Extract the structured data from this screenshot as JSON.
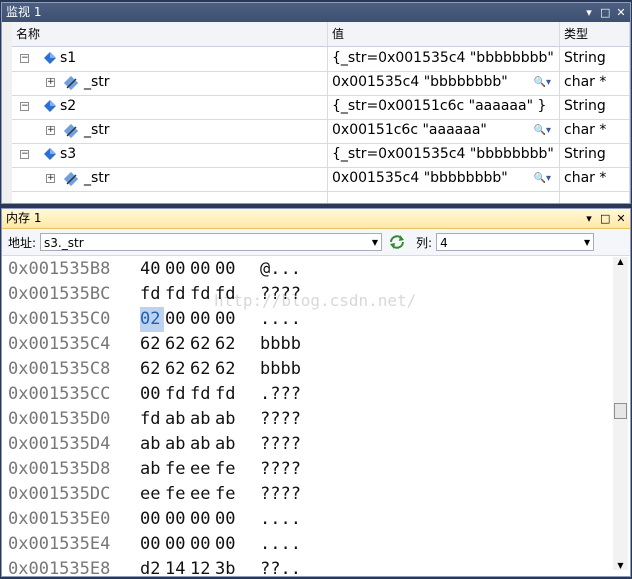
{
  "watch": {
    "title": "监视 1",
    "columns": [
      "名称",
      "值",
      "类型"
    ],
    "rows": [
      {
        "name": "s1",
        "value": "{_str=0x001535c4 \"bbbbbbbb\"",
        "type": "String",
        "level": 0
      },
      {
        "name": "_str",
        "value": "0x001535c4 \"bbbbbbbb\"",
        "type": "char *",
        "level": 1
      },
      {
        "name": "s2",
        "value": "{_str=0x00151c6c \"aaaaaa\" }",
        "type": "String",
        "level": 0
      },
      {
        "name": "_str",
        "value": "0x00151c6c \"aaaaaa\"",
        "type": "char *",
        "level": 1
      },
      {
        "name": "s3",
        "value": "{_str=0x001535c4 \"bbbbbbbb\"",
        "type": "String",
        "level": 0
      },
      {
        "name": "_str",
        "value": "0x001535c4 \"bbbbbbbb\"",
        "type": "char *",
        "level": 1
      }
    ]
  },
  "memory": {
    "title": "内存 1",
    "address_label": "地址:",
    "address_value": "s3._str",
    "columns_label": "列:",
    "columns_value": "4",
    "watermark": "http://blog.csdn.net/",
    "lines": [
      {
        "addr": "0x001535B8",
        "bytes": [
          "40",
          "00",
          "00",
          "00"
        ],
        "ascii": "@..."
      },
      {
        "addr": "0x001535BC",
        "bytes": [
          "fd",
          "fd",
          "fd",
          "fd"
        ],
        "ascii": "????"
      },
      {
        "addr": "0x001535C0",
        "bytes": [
          "02",
          "00",
          "00",
          "00"
        ],
        "ascii": "...."
      },
      {
        "addr": "0x001535C4",
        "bytes": [
          "62",
          "62",
          "62",
          "62"
        ],
        "ascii": "bbbb"
      },
      {
        "addr": "0x001535C8",
        "bytes": [
          "62",
          "62",
          "62",
          "62"
        ],
        "ascii": "bbbb"
      },
      {
        "addr": "0x001535CC",
        "bytes": [
          "00",
          "fd",
          "fd",
          "fd"
        ],
        "ascii": ".???"
      },
      {
        "addr": "0x001535D0",
        "bytes": [
          "fd",
          "ab",
          "ab",
          "ab"
        ],
        "ascii": "????"
      },
      {
        "addr": "0x001535D4",
        "bytes": [
          "ab",
          "ab",
          "ab",
          "ab"
        ],
        "ascii": "????"
      },
      {
        "addr": "0x001535D8",
        "bytes": [
          "ab",
          "fe",
          "ee",
          "fe"
        ],
        "ascii": "????"
      },
      {
        "addr": "0x001535DC",
        "bytes": [
          "ee",
          "fe",
          "ee",
          "fe"
        ],
        "ascii": "????"
      },
      {
        "addr": "0x001535E0",
        "bytes": [
          "00",
          "00",
          "00",
          "00"
        ],
        "ascii": "...."
      },
      {
        "addr": "0x001535E4",
        "bytes": [
          "00",
          "00",
          "00",
          "00"
        ],
        "ascii": "...."
      },
      {
        "addr": "0x001535E8",
        "bytes": [
          "d2",
          "14",
          "12",
          "3b"
        ],
        "ascii": "??.."
      }
    ]
  }
}
